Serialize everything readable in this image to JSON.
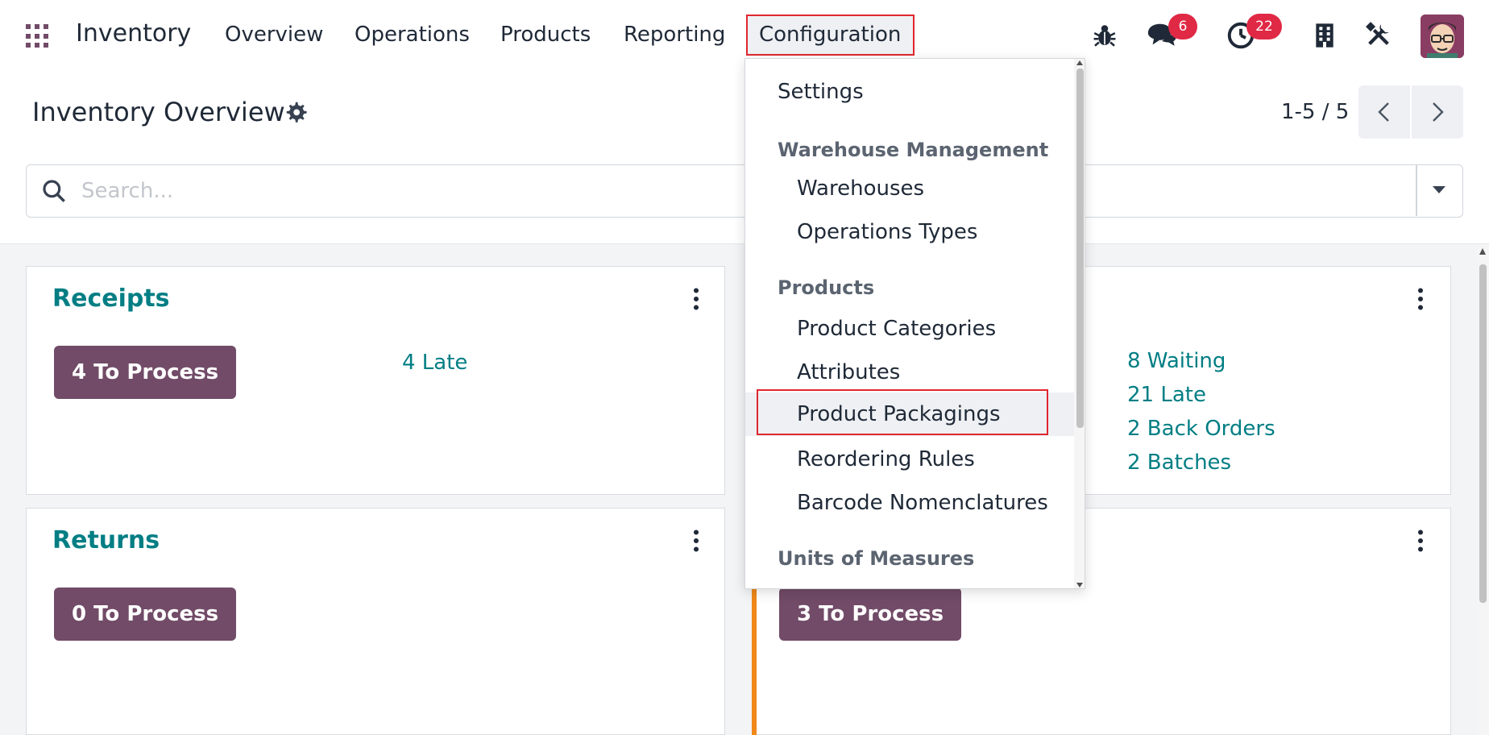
{
  "navbar": {
    "brand": "Inventory",
    "menu": [
      "Overview",
      "Operations",
      "Products",
      "Reporting"
    ],
    "active_menu": "Configuration",
    "messages_count": "6",
    "activities_count": "22"
  },
  "control_panel": {
    "title": "Inventory Overview",
    "pager": "1-5 / 5",
    "search_placeholder": "Search..."
  },
  "cards": {
    "receipts": {
      "title": "Receipts",
      "button": "4 To Process",
      "late": "4 Late"
    },
    "delivery": {
      "waiting": "8 Waiting",
      "late": "21 Late",
      "back_orders": "2 Back Orders",
      "batches": "2 Batches"
    },
    "returns": {
      "title": "Returns",
      "button": "0 To Process"
    },
    "fourth": {
      "button": "3 To Process"
    }
  },
  "dropdown": {
    "settings": "Settings",
    "warehouse_header": "Warehouse Management",
    "warehouses": "Warehouses",
    "operations_types": "Operations Types",
    "products_header": "Products",
    "product_categories": "Product Categories",
    "attributes": "Attributes",
    "product_packagings": "Product Packagings",
    "reordering_rules": "Reordering Rules",
    "barcode_nomenclatures": "Barcode Nomenclatures",
    "uom_header": "Units of Measures"
  },
  "colors": {
    "brand": "#714B67",
    "link": "#017e84",
    "badge": "#e02945",
    "highlight": "#e0262e"
  }
}
